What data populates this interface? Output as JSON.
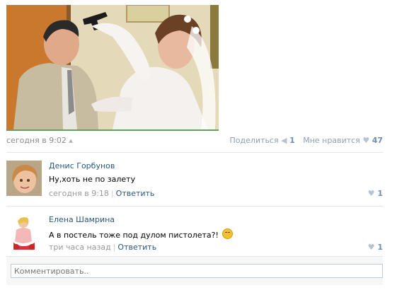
{
  "post": {
    "time": "сегодня в 9:02",
    "share_label": "Поделиться",
    "share_count": "1",
    "like_label": "Мне нравится",
    "like_count": "47"
  },
  "comments": [
    {
      "author": "Денис Горбунов",
      "text": "Ну,хоть не по залету",
      "time": "сегодня в 9:18",
      "reply_label": "Ответить",
      "likes": "1"
    },
    {
      "author": "Елена Шамрина",
      "text": "А в постель тоже под дулом пистолета?!",
      "time": "три часа назад",
      "reply_label": "Ответить",
      "likes": "1"
    }
  ],
  "comment_input": {
    "placeholder": "Комментировать.."
  },
  "colors": {
    "link": "#2b587a",
    "muted": "#999999",
    "photo_underline": "#5fa35c",
    "like_count": "#6e8fb0"
  },
  "icons": [
    "android-icon",
    "megaphone-icon",
    "heart-icon",
    "emoji-icon"
  ]
}
